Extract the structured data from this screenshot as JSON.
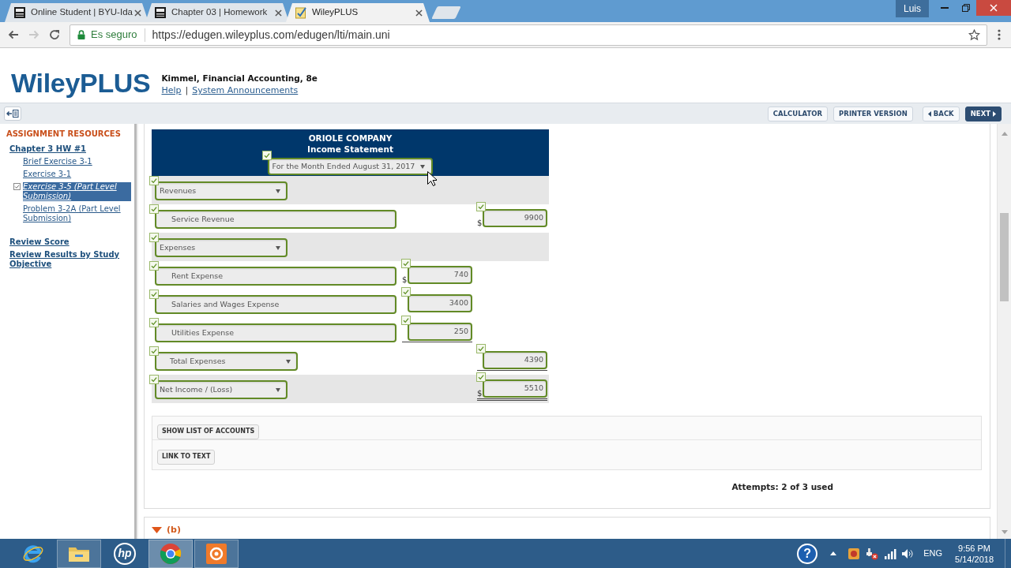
{
  "browser": {
    "tabs": [
      {
        "title": "Online Student | BYU-Ida",
        "kind": "badge",
        "selected": false
      },
      {
        "title": "Chapter 03 | Homework",
        "kind": "badge",
        "selected": false
      },
      {
        "title": "WileyPLUS",
        "kind": "notepad",
        "selected": true
      }
    ],
    "user": "Luis",
    "navigation": [
      {
        "kind": "back",
        "disabled": false
      },
      {
        "kind": "forward",
        "disabled": true
      },
      {
        "kind": "reload",
        "disabled": false
      }
    ],
    "security_label": "Es seguro",
    "url": "https://edugen.wileyplus.com/edugen/lti/main.uni"
  },
  "header": {
    "logo": "WileyPLUS",
    "course": "Kimmel, Financial Accounting, 8e",
    "links": [
      "Help",
      "System Announcements"
    ],
    "link_separator": "|"
  },
  "toolbar": {
    "buttons": [
      {
        "label": "CALCULATOR",
        "kind": "plain"
      },
      {
        "label": "PRINTER VERSION",
        "kind": "plain"
      },
      {
        "label": "BACK",
        "kind": "back"
      },
      {
        "label": "NEXT",
        "kind": "next"
      }
    ]
  },
  "sidebar": {
    "heading": "ASSIGNMENT RESOURCES",
    "assignment": {
      "label": "Chapter 3 HW #1",
      "children": [
        {
          "label": "Brief Exercise 3-1",
          "selected": false
        },
        {
          "label": "Exercise 3-1",
          "selected": false
        },
        {
          "label": "Exercise 3-5 (Part Level Submission)",
          "selected": true
        },
        {
          "label": "Problem 3-2A (Part Level Submission)",
          "selected": false
        }
      ]
    },
    "links": [
      "Review Score",
      "Review Results by Study Objective"
    ]
  },
  "statement": {
    "company": "ORIOLE COMPANY",
    "title": "Income Statement",
    "period": {
      "value": "For the Month Ended August 31, 2017",
      "correct": true
    },
    "rows": [
      {
        "kind": "heading",
        "label": "Revenues",
        "correct": true
      },
      {
        "kind": "account",
        "label": "Service Revenue",
        "correct": true,
        "outer_amount": {
          "currency": "$",
          "value": "9900",
          "correct": true
        }
      },
      {
        "kind": "heading",
        "label": "Expenses",
        "correct": true
      },
      {
        "kind": "account",
        "label": "Rent Expense",
        "correct": true,
        "inner_amount": {
          "currency": "$",
          "value": "740",
          "correct": true
        }
      },
      {
        "kind": "account",
        "label": "Salaries and Wages Expense",
        "correct": true,
        "inner_amount": {
          "value": "3400",
          "correct": true
        }
      },
      {
        "kind": "account",
        "label": "Utilities Expense",
        "correct": true,
        "inner_amount": {
          "value": "250",
          "correct": true,
          "underlined": true
        }
      },
      {
        "kind": "total",
        "label": "Total Expenses",
        "correct": true,
        "outer_amount": {
          "value": "4390",
          "correct": true,
          "underlined": true
        }
      },
      {
        "kind": "heading",
        "label": "Net Income / (Loss)",
        "correct": true,
        "outer_amount": {
          "currency": "$",
          "value": "5510",
          "correct": true,
          "double_underlined": true
        }
      }
    ]
  },
  "resources": {
    "buttons": [
      "SHOW LIST OF ACCOUNTS",
      "LINK TO TEXT"
    ]
  },
  "attempts": "Attempts: 2 of 3 used",
  "next_part": {
    "label": "(b)",
    "expanded": true
  },
  "taskbar": {
    "apps": [
      {
        "kind": "e-browser",
        "running": false,
        "selected": false
      },
      {
        "kind": "folder",
        "running": true,
        "selected": false
      },
      {
        "kind": "badge",
        "text": "hp",
        "running": false,
        "selected": false
      },
      {
        "kind": "chrome",
        "running": true,
        "selected": true
      },
      {
        "kind": "recorder",
        "running": true,
        "selected": false
      }
    ],
    "help": "?",
    "language": "ENG",
    "time": "9:56 PM",
    "date": "5/14/2018"
  }
}
